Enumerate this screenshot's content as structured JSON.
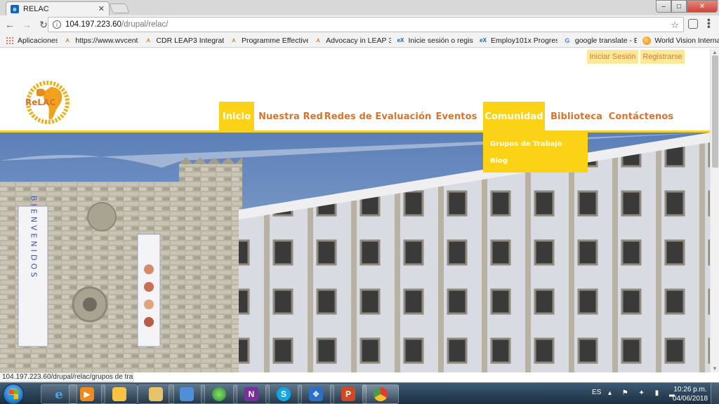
{
  "browser": {
    "tab_title": "RELAC",
    "tab_favicon": "e",
    "tab_close": "✕",
    "url_host": "104.197.223.60",
    "url_path": "/drupal/relac/",
    "bookmarks": [
      {
        "label": "Aplicaciones",
        "icon": "apps-grid-icon"
      },
      {
        "label": "https://www.wvcentr",
        "icon": "leap-icon"
      },
      {
        "label": "CDR LEAP3 Integrati",
        "icon": "leap-icon"
      },
      {
        "label": "Programme Effective",
        "icon": "leap-icon"
      },
      {
        "label": "Advocacy in LEAP 3",
        "icon": "leap-icon"
      },
      {
        "label": "Inicie sesión o regist",
        "icon": "edx-icon"
      },
      {
        "label": "Employ101x Progres",
        "icon": "edx-icon"
      },
      {
        "label": "google translate - B",
        "icon": "google-icon"
      },
      {
        "label": "World Vision Interna",
        "icon": "worldvision-icon"
      }
    ],
    "status_url": "104.197.223.60/drupal/relac/grupos de trabajo"
  },
  "site": {
    "auth": {
      "login": "Iniciar Sesión",
      "register": "Registrarse"
    },
    "logo_text": "ReLAC",
    "nav": [
      {
        "label": "Inicio",
        "active": true
      },
      {
        "label": "Nuestra Red",
        "active": false
      },
      {
        "label": "Redes de Evaluación",
        "active": false
      },
      {
        "label": "Eventos",
        "active": false
      },
      {
        "label": "Comunidad",
        "active": true
      },
      {
        "label": "Biblioteca",
        "active": false
      },
      {
        "label": "Contáctenos",
        "active": false
      }
    ],
    "dropdown": [
      "Grupos de Trabajo",
      "Blog"
    ],
    "hero_banner_text": "BIENVENIDOS"
  },
  "taskbar": {
    "apps": [
      "internet-explorer-icon",
      "media-player-icon",
      "folder-icon",
      "file-explorer-icon",
      "remote-desktop-icon",
      "green-sphere-icon",
      "onenote-icon",
      "skype-icon",
      "dropbox-like-icon",
      "powerpoint-icon",
      "chrome-icon"
    ],
    "language": "ES",
    "time": "10:26 p.m.",
    "date": "04/06/2018"
  },
  "colors": {
    "accent_yellow": "#fbd215",
    "nav_orange": "#d8742b",
    "auth_bg": "#fbe89a"
  }
}
